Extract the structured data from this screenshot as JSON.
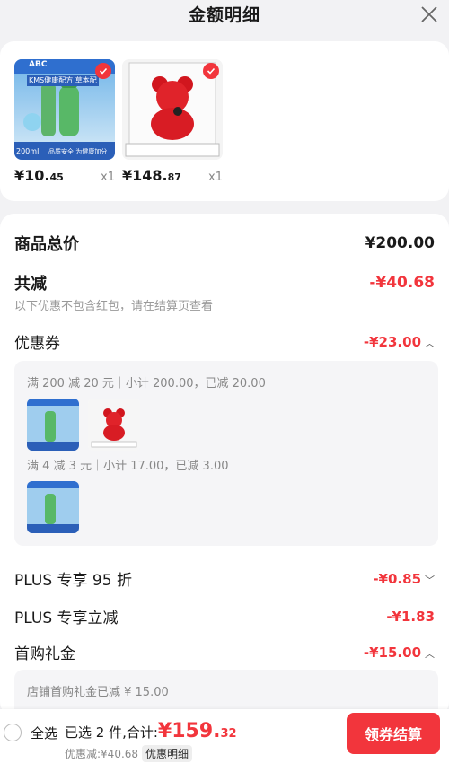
{
  "header": {
    "title": "金额明细"
  },
  "products": [
    {
      "price_int": "¥10.",
      "price_dec": "45",
      "qty": "x1",
      "img_text": {
        "brand": "ABC",
        "line1": "KMS健康配方 草本配",
        "size": "200ml",
        "foot": "品质安全 为健康加分"
      }
    },
    {
      "price_int": "¥148.",
      "price_dec": "87",
      "qty": "x1"
    }
  ],
  "summary": {
    "total_label": "商品总价",
    "total_value": "¥200.00",
    "reduce_label": "共减",
    "reduce_value": "-¥40.68",
    "note": "以下优惠不包含红包，请在结算页查看",
    "coupon_label": "优惠券",
    "coupon_value": "-¥23.00",
    "coupon_lines": [
      "满 200 减 20 元｜小计 200.00，已减 20.00",
      "满 4 减 3 元｜小计 17.00，已减 3.00"
    ],
    "plus95_label": "PLUS 专享 95 折",
    "plus95_value": "-¥0.85",
    "plus_instant_label": "PLUS 专享立减",
    "plus_instant_value": "-¥1.83",
    "first_gift_label": "首购礼金",
    "first_gift_value": "-¥15.00",
    "first_gift_note": "店铺首购礼金已减 ¥ 15.00"
  },
  "bottom": {
    "select_all": "全选",
    "selected_text": "已选 2 件,合计:",
    "total_int": "¥159.",
    "total_dec": "32",
    "discount_text": "优惠减:¥40.68",
    "detail_btn": "优惠明细",
    "pay_btn": "领券结算"
  },
  "colors": {
    "accent": "#f2353c"
  }
}
